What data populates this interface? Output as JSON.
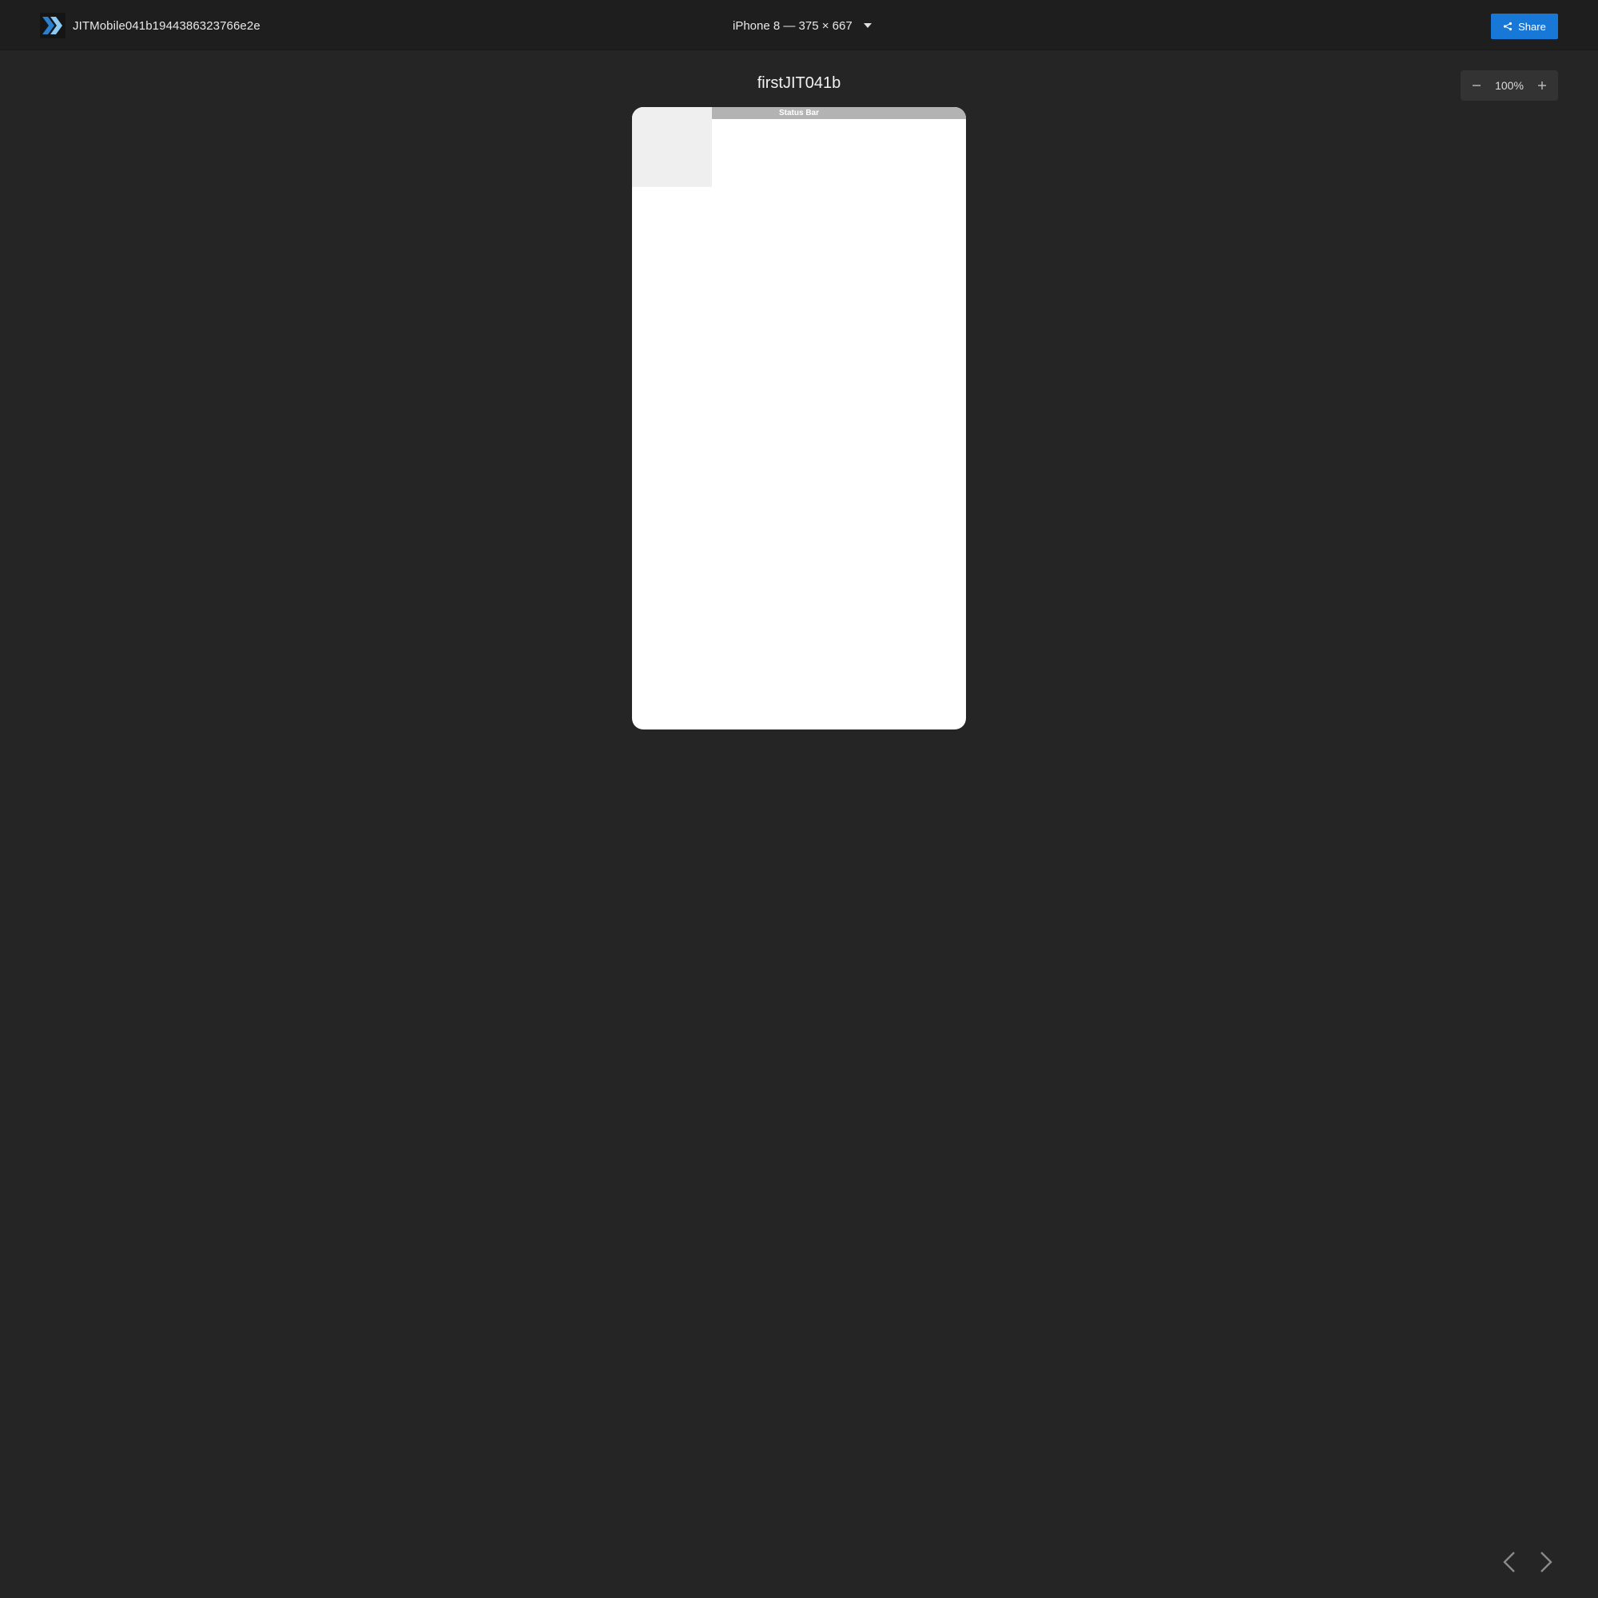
{
  "header": {
    "project_name": "JITMobile041b1944386323766e2e",
    "device": "iPhone 8 — 375 × 667",
    "share_label": "Share",
    "logo_icon": "chevron-logo-icon"
  },
  "screen": {
    "title": "firstJIT041b",
    "status_bar_label": "Status Bar"
  },
  "zoom": {
    "value": "100%",
    "zoom_out_icon": "minus-icon",
    "zoom_in_icon": "plus-icon"
  },
  "navigation": {
    "prev_icon": "chevron-left-icon",
    "next_icon": "chevron-right-icon"
  },
  "colors": {
    "background": "#252525",
    "topbar": "#1e1e1e",
    "accent": "#1878d8",
    "status_bar": "#b3b3b3",
    "placeholder": "#efefef"
  }
}
